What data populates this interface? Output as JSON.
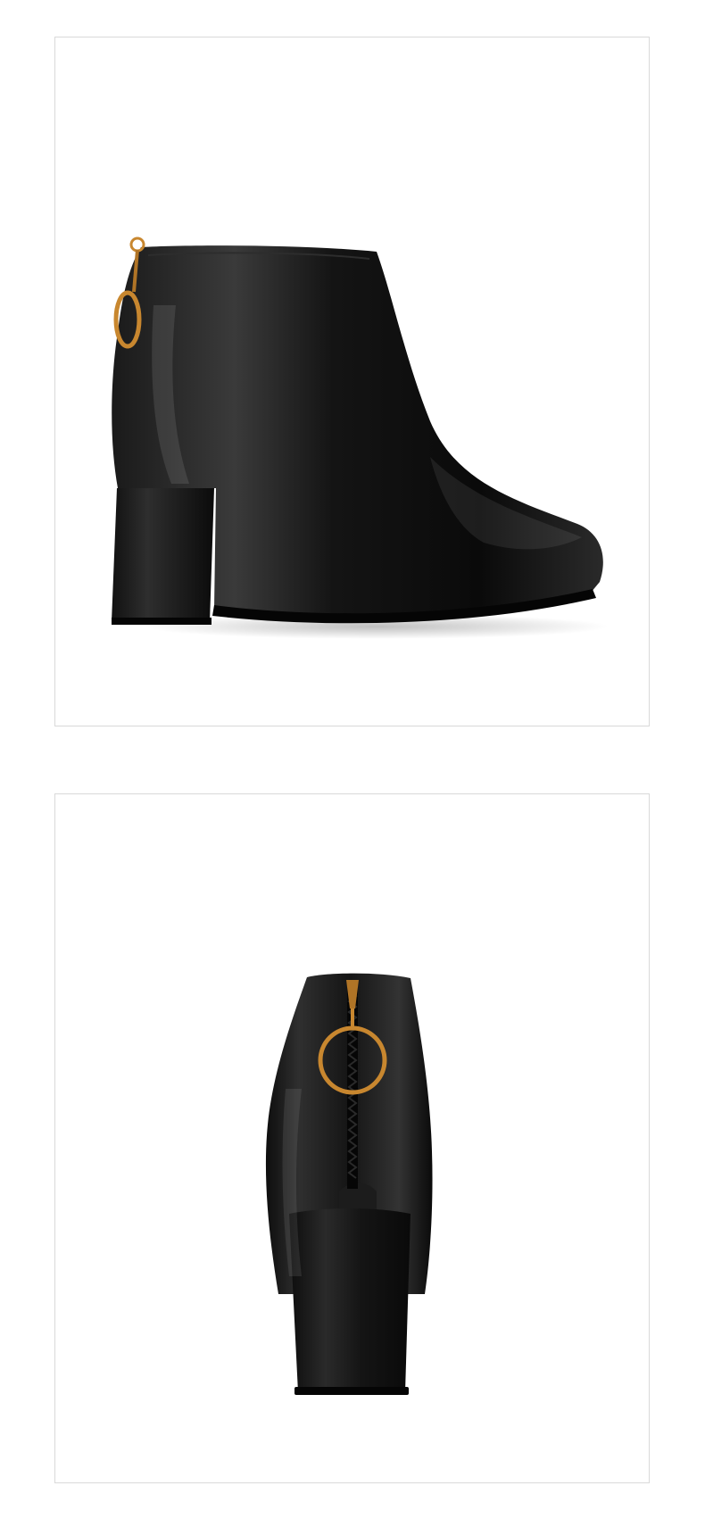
{
  "page": {
    "background_color": "#ffffff",
    "border_color": "#d9d9d9"
  },
  "photos": [
    {
      "subject": "boot-side-view",
      "colors": {
        "leather": "#0d0d0d",
        "hardware": "#c8872f"
      }
    },
    {
      "subject": "boot-back-view",
      "colors": {
        "leather": "#0d0d0d",
        "hardware": "#c8872f"
      }
    }
  ]
}
